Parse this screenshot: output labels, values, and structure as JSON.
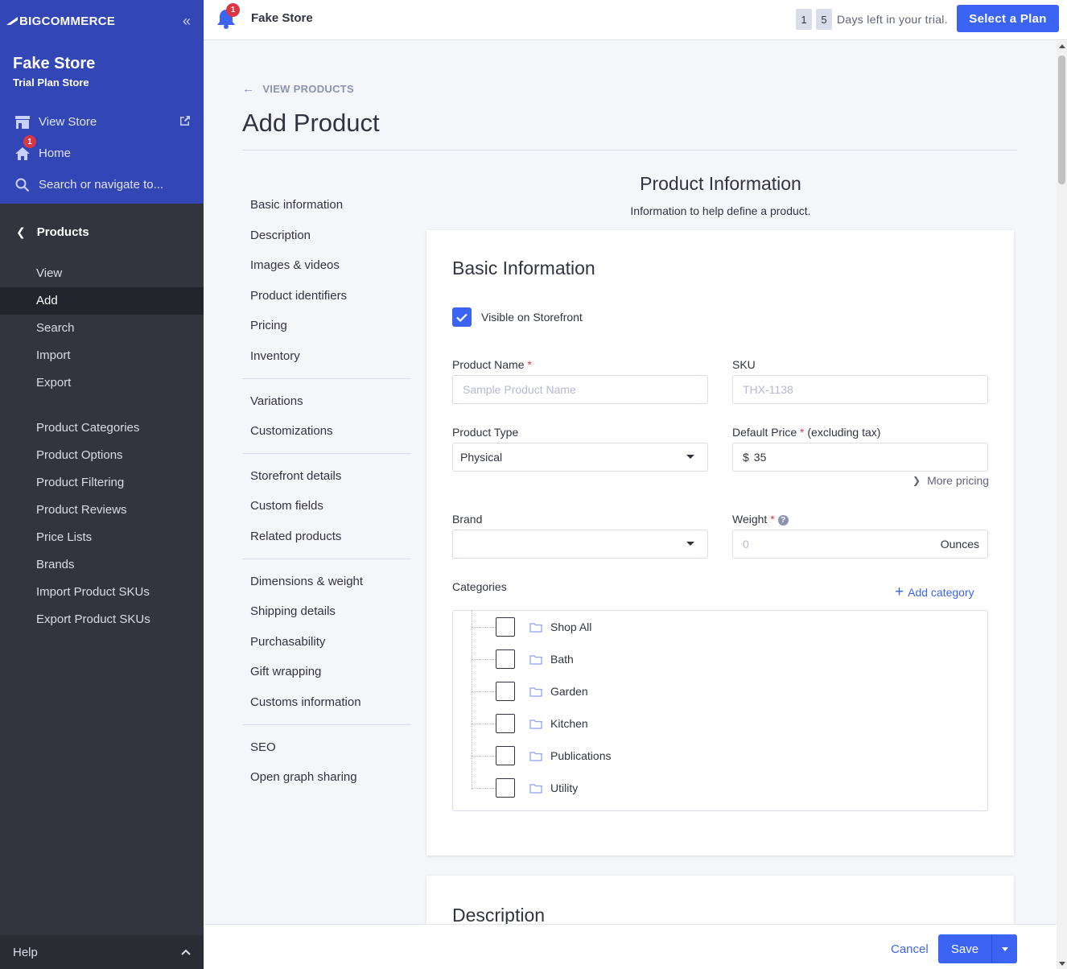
{
  "sidebar": {
    "logo": "BIGCOMMERCE",
    "store_name": "Fake Store",
    "store_plan": "Trial Plan Store",
    "links": [
      {
        "label": "View Store",
        "icon": "storefront-icon"
      },
      {
        "label": "Home",
        "icon": "home-icon",
        "badge": "1"
      },
      {
        "label": "Search or navigate to...",
        "icon": "search-icon"
      }
    ],
    "section": "Products",
    "items": [
      "View",
      "Add",
      "Search",
      "Import",
      "Export"
    ],
    "items2": [
      "Product Categories",
      "Product Options",
      "Product Filtering",
      "Product Reviews",
      "Price Lists",
      "Brands",
      "Import Product SKUs",
      "Export Product SKUs"
    ],
    "active_item": "Add",
    "help": "Help"
  },
  "topbar": {
    "bell_badge": "1",
    "store_name": "Fake Store",
    "trial_digits": [
      "1",
      "5"
    ],
    "trial_text": "Days left in your trial.",
    "plan_button": "Select a Plan"
  },
  "main": {
    "breadcrumb": "VIEW PRODUCTS",
    "title": "Add Product",
    "toc": [
      [
        "Basic information",
        "Description",
        "Images & videos",
        "Product identifiers",
        "Pricing",
        "Inventory"
      ],
      [
        "Variations",
        "Customizations"
      ],
      [
        "Storefront details",
        "Custom fields",
        "Related products"
      ],
      [
        "Dimensions & weight",
        "Shipping details",
        "Purchasability",
        "Gift wrapping",
        "Customs information"
      ],
      [
        "SEO",
        "Open graph sharing"
      ]
    ],
    "section_title": "Product Information",
    "section_subtitle": "Information to help define a product.",
    "card_title": "Basic Information",
    "visible_label": "Visible on Storefront",
    "product_name_label": "Product Name",
    "product_name_placeholder": "Sample Product Name",
    "sku_label": "SKU",
    "sku_placeholder": "THX-1138",
    "product_type_label": "Product Type",
    "product_type_value": "Physical",
    "price_label": "Default Price",
    "price_suffix_label": "(excluding tax)",
    "price_currency": "$",
    "price_value": "35",
    "more_pricing": "More pricing",
    "brand_label": "Brand",
    "weight_label": "Weight",
    "weight_placeholder": "0",
    "weight_unit": "Ounces",
    "categories_label": "Categories",
    "add_category": "Add category",
    "categories": [
      "Shop All",
      "Bath",
      "Garden",
      "Kitchen",
      "Publications",
      "Utility"
    ],
    "description_title": "Description"
  },
  "footer": {
    "cancel": "Cancel",
    "save": "Save"
  },
  "colors": {
    "accent": "#3c64f4",
    "sidebar_dark": "#34343f",
    "sidebar_top": "#3246b5",
    "required": "#db3643"
  }
}
